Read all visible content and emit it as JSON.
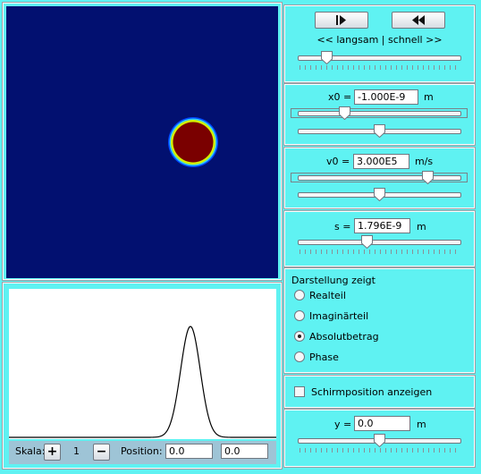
{
  "simulation": {
    "field_colors": {
      "background": "#021070",
      "blob": "#7a0000",
      "ring": [
        "#d4f000",
        "#2ecbff",
        "#0046ff"
      ]
    },
    "plot_colors": {
      "background": "#ffffff",
      "curve": "#000000"
    }
  },
  "bottom_bar": {
    "scale_label": "Skala:",
    "plus_label": "+",
    "scale_value": "1",
    "minus_label": "−",
    "position_label": "Position:",
    "position_x": "0.0",
    "position_y": "0.0"
  },
  "playback": {
    "play_icon": "play-icon",
    "rewind_icon": "rewind-icon",
    "speed_label": "<< langsam | schnell >>",
    "speed_level": 0.15
  },
  "x0": {
    "label": "x0 =",
    "value": "-1.000E-9",
    "unit": "m",
    "coarse_level": 0.27,
    "fine_level": 0.5
  },
  "v0": {
    "label": "v0 =",
    "value": "3.000E5",
    "unit": "m/s",
    "coarse_level": 0.82,
    "fine_level": 0.5
  },
  "s": {
    "label": "s =",
    "value": "1.796E-9",
    "unit": "m",
    "level": 0.42
  },
  "display": {
    "title": "Darstellung zeigt",
    "options": [
      "Realteil",
      "Imaginärteil",
      "Absolutbetrag",
      "Phase"
    ],
    "selected": 2
  },
  "screen_position": {
    "label": "Schirmposition anzeigen",
    "checked": false
  },
  "y": {
    "label": "y =",
    "value": "0.0",
    "unit": "m",
    "level": 0.5
  }
}
